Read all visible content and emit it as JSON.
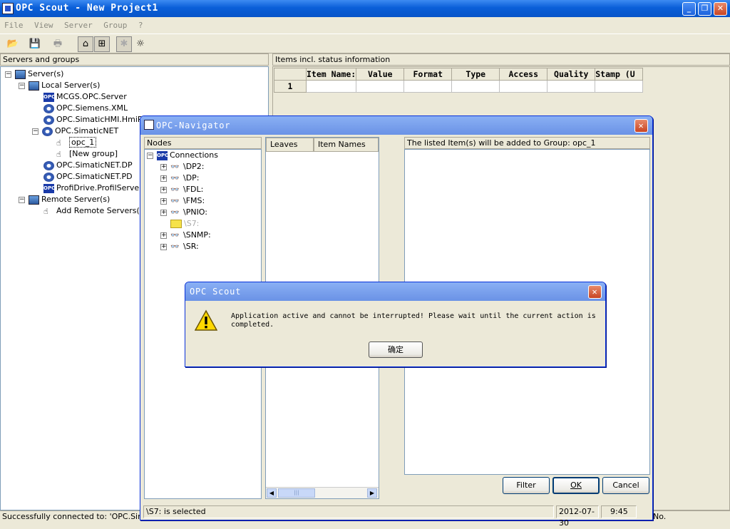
{
  "app": {
    "title": "OPC Scout - New Project1",
    "menu": [
      "File",
      "View",
      "Server",
      "Group",
      "?"
    ]
  },
  "toolbar": {
    "icons": [
      "open-icon",
      "save-icon",
      "print-icon",
      "network-icon",
      "add-item-icon",
      "bug-icon",
      "bulb-icon"
    ]
  },
  "left_panel": {
    "header": "Servers and groups",
    "tree": [
      {
        "label": "Server(s)",
        "icon": "servers-icon",
        "expander": "-"
      },
      {
        "label": "Local Server(s)",
        "icon": "local-server-icon",
        "expander": "-"
      },
      {
        "label": "MCGS.OPC.Server",
        "icon": "opc-icon"
      },
      {
        "label": "OPC.Siemens.XML",
        "icon": "gear-icon"
      },
      {
        "label": "OPC.SimaticHMI.HmiRT",
        "icon": "gear-icon"
      },
      {
        "label": "OPC.SimaticNET",
        "icon": "gear-icon",
        "expander": "-"
      },
      {
        "label": "opc_1",
        "icon": "group-icon",
        "selected": true
      },
      {
        "label": "[New group]",
        "icon": "group-icon"
      },
      {
        "label": "OPC.SimaticNET.DP",
        "icon": "gear-icon"
      },
      {
        "label": "OPC.SimaticNET.PD",
        "icon": "gear-icon"
      },
      {
        "label": "ProfiDrive.ProfilServer",
        "icon": "opc-icon"
      },
      {
        "label": "Remote Server(s)",
        "icon": "remote-server-icon",
        "expander": "-"
      },
      {
        "label": "Add Remote Servers(s)",
        "icon": "hand-icon"
      }
    ]
  },
  "right_panel": {
    "header": "Items incl. status information",
    "columns": [
      "Item Name:",
      "Value",
      "Format",
      "Type",
      "Access",
      "Quality",
      "Stamp (U"
    ],
    "rows": [
      [
        "1",
        "",
        "",
        "",
        "",
        "",
        "",
        ""
      ]
    ]
  },
  "main_status": "Successfully connected to: 'OPC.Simatic",
  "main_status_right": "No.",
  "navigator": {
    "title": "OPC-Navigator",
    "nodes_header": "Nodes",
    "nodes": [
      {
        "label": "Connections",
        "icon": "opc-icon",
        "expander": "-"
      },
      {
        "label": "\\DP2:",
        "icon": "binoculars-icon",
        "expander": "+"
      },
      {
        "label": "\\DP:",
        "icon": "binoculars-icon",
        "expander": "+"
      },
      {
        "label": "\\FDL:",
        "icon": "binoculars-icon",
        "expander": "+"
      },
      {
        "label": "\\FMS:",
        "icon": "binoculars-icon",
        "expander": "+"
      },
      {
        "label": "\\PNIO:",
        "icon": "binoculars-icon",
        "expander": "+"
      },
      {
        "label": "\\S7:",
        "icon": "folder-icon",
        "selected": true
      },
      {
        "label": "\\SNMP:",
        "icon": "binoculars-icon",
        "expander": "+"
      },
      {
        "label": "\\SR:",
        "icon": "binoculars-icon",
        "expander": "+"
      }
    ],
    "leaves_header": "Leaves",
    "item_names_header": "Item Names",
    "group_header": "The listed Item(s) will be added to Group: opc_1",
    "filter_button": "Filter",
    "ok_button": "OK",
    "cancel_button": "Cancel",
    "status": "\\S7: is selected",
    "date": "2012-07-30",
    "time": "9:45"
  },
  "message": {
    "title": "OPC Scout",
    "text": "Application active and cannot be interrupted! Please wait until the current action is completed.",
    "button": "确定",
    "icon": "warning-icon"
  }
}
